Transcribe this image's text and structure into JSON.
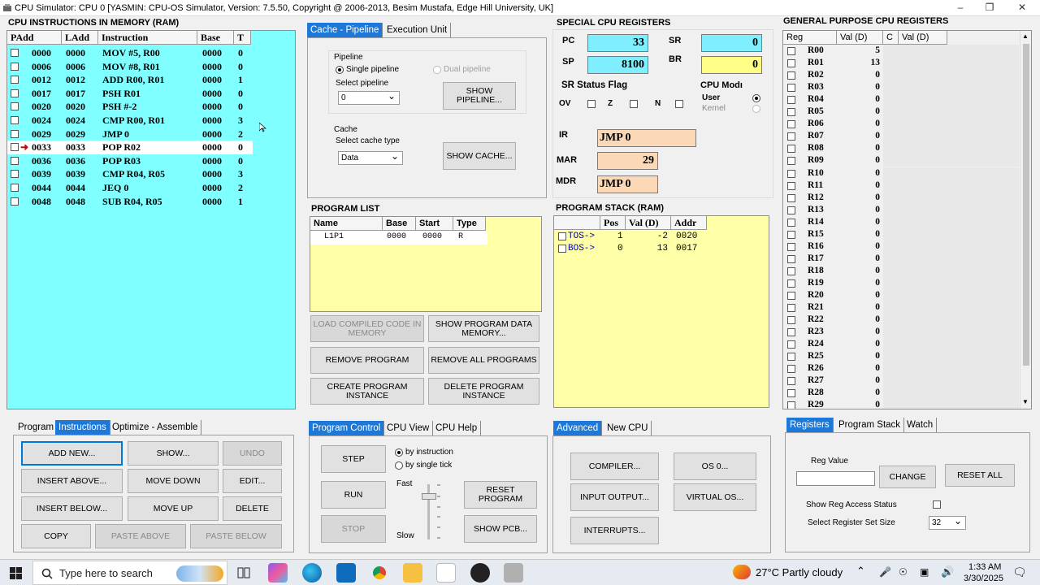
{
  "window": {
    "title": "CPU Simulator: CPU 0      [YASMIN: CPU-OS Simulator,  Version: 7.5.50,  Copyright @ 2006-2013, Besim Mustafa, Edge Hill University, UK]"
  },
  "instructions": {
    "title": "CPU INSTRUCTIONS IN MEMORY (RAM)",
    "columns": [
      "PAdd",
      "LAdd",
      "Instruction",
      "Base",
      "T"
    ],
    "current_row": 7,
    "rows": [
      {
        "padd": "0000",
        "ladd": "0000",
        "instr": "MOV #5, R00",
        "base": "0000",
        "t": "0"
      },
      {
        "padd": "0006",
        "ladd": "0006",
        "instr": "MOV #8, R01",
        "base": "0000",
        "t": "0"
      },
      {
        "padd": "0012",
        "ladd": "0012",
        "instr": "ADD R00, R01",
        "base": "0000",
        "t": "1"
      },
      {
        "padd": "0017",
        "ladd": "0017",
        "instr": "PSH R01",
        "base": "0000",
        "t": "0"
      },
      {
        "padd": "0020",
        "ladd": "0020",
        "instr": "PSH #-2",
        "base": "0000",
        "t": "0"
      },
      {
        "padd": "0024",
        "ladd": "0024",
        "instr": "CMP R00, R01",
        "base": "0000",
        "t": "3"
      },
      {
        "padd": "0029",
        "ladd": "0029",
        "instr": "JMP 0",
        "base": "0000",
        "t": "2"
      },
      {
        "padd": "0033",
        "ladd": "0033",
        "instr": "POP R02",
        "base": "0000",
        "t": "0"
      },
      {
        "padd": "0036",
        "ladd": "0036",
        "instr": "POP R03",
        "base": "0000",
        "t": "0"
      },
      {
        "padd": "0039",
        "ladd": "0039",
        "instr": "CMP R04, R05",
        "base": "0000",
        "t": "3"
      },
      {
        "padd": "0044",
        "ladd": "0044",
        "instr": "JEQ 0",
        "base": "0000",
        "t": "2"
      },
      {
        "padd": "0048",
        "ladd": "0048",
        "instr": "SUB R04, R05",
        "base": "0000",
        "t": "1"
      }
    ],
    "tabs": [
      "Program",
      "Instructions",
      "Optimize - Assemble"
    ],
    "active_tab": 1,
    "buttons": {
      "add_new": "ADD NEW...",
      "show": "SHOW...",
      "undo": "UNDO",
      "insert_above": "INSERT ABOVE...",
      "move_down": "MOVE DOWN",
      "edit": "EDIT...",
      "insert_below": "INSERT BELOW...",
      "move_up": "MOVE UP",
      "delete": "DELETE",
      "copy": "COPY",
      "paste_above": "PASTE ABOVE",
      "paste_below": "PASTE BELOW"
    }
  },
  "cache_pipeline": {
    "tabs": [
      "Cache - Pipeline",
      "Execution Unit"
    ],
    "pipeline_label": "Pipeline",
    "single_pipeline": "Single pipeline",
    "dual_pipeline": "Dual pipeline",
    "select_pipeline_label": "Select pipeline",
    "select_pipeline_value": "0",
    "show_pipeline": "SHOW PIPELINE...",
    "cache_label": "Cache",
    "select_cache_label": "Select cache type",
    "select_cache_value": "Data",
    "show_cache": "SHOW    CACHE..."
  },
  "program_list": {
    "title": "PROGRAM LIST",
    "columns": [
      "Name",
      "Base",
      "Start",
      "Type"
    ],
    "rows": [
      {
        "name": "L1P1",
        "base": "0000",
        "start": "0000",
        "type": "R"
      }
    ],
    "buttons": {
      "load_compiled": "LOAD COMPILED CODE IN MEMORY",
      "show_program_data": "SHOW PROGRAM  DATA MEMORY...",
      "remove_program": "REMOVE PROGRAM",
      "remove_all": "REMOVE ALL PROGRAMS",
      "create_instance": "CREATE PROGRAM INSTANCE",
      "delete_instance": "DELETE PROGRAM INSTANCE"
    }
  },
  "program_control": {
    "tabs": [
      "Program Control",
      "CPU View",
      "CPU Help"
    ],
    "step": "STEP",
    "run": "RUN",
    "stop": "STOP",
    "by_instruction": "by instruction",
    "by_single_tick": "by single tick",
    "fast": "Fast",
    "slow": "Slow",
    "reset_program": "RESET PROGRAM",
    "show_pcb": "SHOW PCB..."
  },
  "special_registers": {
    "title": "SPECIAL CPU REGISTERS",
    "pc_label": "PC",
    "pc": "33",
    "sr_label": "SR",
    "sr": "0",
    "sp_label": "SP",
    "sp": "8100",
    "br_label": "BR",
    "br": "0",
    "sr_status_title": "SR Status Flag",
    "flags": [
      "OV",
      "Z",
      "N"
    ],
    "cpu_mode_title": "CPU Modı",
    "mode_user": "User",
    "mode_kernel": "Kernel",
    "ir_label": "IR",
    "ir": "JMP 0",
    "mar_label": "MAR",
    "mar": "29",
    "mdr_label": "MDR",
    "mdr": "JMP 0"
  },
  "program_stack": {
    "title": "PROGRAM STACK (RAM)",
    "columns": [
      "",
      "Pos",
      "Val (D)",
      "Addr"
    ],
    "rows": [
      {
        "label": "TOS->",
        "pos": "1",
        "val": "-2",
        "addr": "0020"
      },
      {
        "label": "BOS->",
        "pos": "0",
        "val": "13",
        "addr": "0017"
      }
    ]
  },
  "advanced": {
    "tabs": [
      "Advanced",
      "New CPU"
    ],
    "compiler": "COMPILER...",
    "os0": "OS 0...",
    "input_output": "INPUT OUTPUT...",
    "virtual_os": "VIRTUAL OS...",
    "interrupts": "INTERRUPTS..."
  },
  "gp_registers": {
    "title": "GENERAL PURPOSE CPU REGISTERS",
    "columns": [
      "Reg",
      "Val (D)",
      "C",
      "Val (D)"
    ],
    "rows": [
      {
        "reg": "R00",
        "val": "5"
      },
      {
        "reg": "R01",
        "val": "13"
      },
      {
        "reg": "R02",
        "val": "0"
      },
      {
        "reg": "R03",
        "val": "0"
      },
      {
        "reg": "R04",
        "val": "0"
      },
      {
        "reg": "R05",
        "val": "0"
      },
      {
        "reg": "R06",
        "val": "0"
      },
      {
        "reg": "R07",
        "val": "0"
      },
      {
        "reg": "R08",
        "val": "0"
      },
      {
        "reg": "R09",
        "val": "0"
      },
      {
        "reg": "R10",
        "val": "0"
      },
      {
        "reg": "R11",
        "val": "0"
      },
      {
        "reg": "R12",
        "val": "0"
      },
      {
        "reg": "R13",
        "val": "0"
      },
      {
        "reg": "R14",
        "val": "0"
      },
      {
        "reg": "R15",
        "val": "0"
      },
      {
        "reg": "R16",
        "val": "0"
      },
      {
        "reg": "R17",
        "val": "0"
      },
      {
        "reg": "R18",
        "val": "0"
      },
      {
        "reg": "R19",
        "val": "0"
      },
      {
        "reg": "R20",
        "val": "0"
      },
      {
        "reg": "R21",
        "val": "0"
      },
      {
        "reg": "R22",
        "val": "0"
      },
      {
        "reg": "R23",
        "val": "0"
      },
      {
        "reg": "R24",
        "val": "0"
      },
      {
        "reg": "R25",
        "val": "0"
      },
      {
        "reg": "R26",
        "val": "0"
      },
      {
        "reg": "R27",
        "val": "0"
      },
      {
        "reg": "R28",
        "val": "0"
      },
      {
        "reg": "R29",
        "val": "0"
      }
    ],
    "tabs": [
      "Registers",
      "Program Stack",
      "Watch"
    ],
    "reg_value_label": "Reg Value",
    "change": "CHANGE",
    "reset_all": "RESET ALL",
    "show_reg_access": "Show Reg Access Status",
    "select_set_size_label": "Select Register Set Size",
    "set_size": "32"
  },
  "taskbar": {
    "search_placeholder": "Type here to search",
    "weather": "27°C  Partly cloudy",
    "time": "1:33 AM",
    "date": "3/30/2025"
  },
  "colors": {
    "cyan": "#7fffff",
    "yellow_light": "#ffffa8",
    "peach": "#fcd9b6",
    "register_cyan": "#7fefff",
    "register_yellow": "#ffff88",
    "accent": "#1e78d7"
  }
}
